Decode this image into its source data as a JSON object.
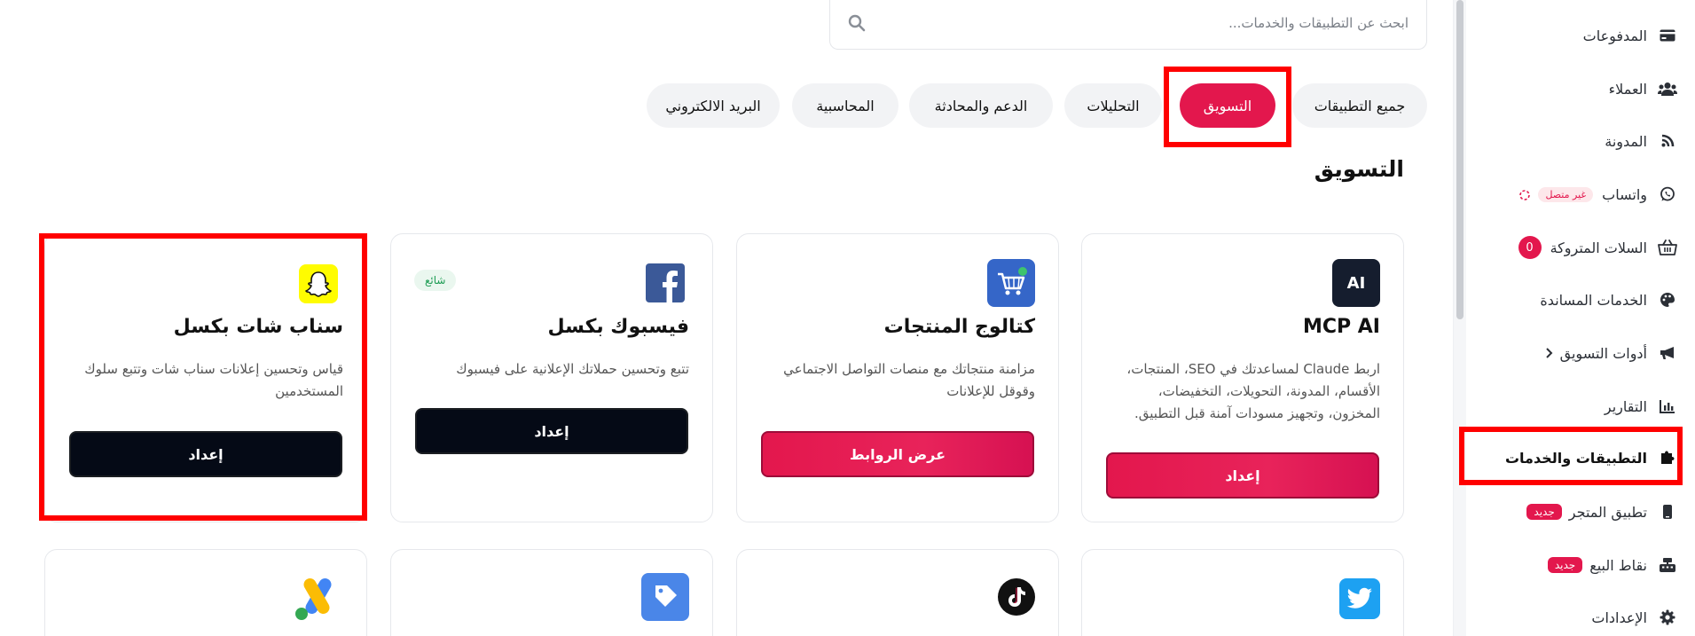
{
  "search": {
    "placeholder": "ابحث عن التطبيقات والخدمات..."
  },
  "tabs": [
    {
      "label": "جميع التطبيقات"
    },
    {
      "label": "التسويق",
      "active": true
    },
    {
      "label": "التحليلات"
    },
    {
      "label": "الدعم والمحادثة"
    },
    {
      "label": "المحاسبية"
    },
    {
      "label": "البريد الالكتروني"
    }
  ],
  "section_title": "التسويق",
  "cards": [
    {
      "name": "MCP AI",
      "logo_text": "AI",
      "icon": "ai-logo-icon",
      "desc": "اربط Claude لمساعدتك في SEO، المنتجات، الأقسام، المدونة، التحويلات، التخفيضات، المخزون، وتجهيز مسودات آمنة قبل التطبيق.",
      "button": "إعداد"
    },
    {
      "name": "كتالوج المنتجات",
      "icon": "cart-icon",
      "desc": "مزامنة منتجاتك مع منصات التواصل الاجتماعي وقوقل للإعلانات",
      "button": "عرض الروابط"
    },
    {
      "name": "فيسبوك بكسل",
      "icon": "facebook-icon",
      "desc": "تتبع وتحسين حملاتك الإعلانية على فيسبوك",
      "button": "إعداد",
      "badge": "شائع"
    },
    {
      "name": "سناب شات بكسل",
      "icon": "snapchat-icon",
      "desc": "قياس وتحسين إعلانات سناب شات وتتبع سلوك المستخدمين",
      "button": "إعداد"
    }
  ],
  "cards_row2": [
    {
      "icon": "twitter-icon"
    },
    {
      "icon": "tiktok-icon"
    },
    {
      "icon": "price-tag-icon"
    },
    {
      "icon": "google-ads-icon"
    }
  ],
  "sidebar": {
    "items": [
      {
        "label": "المدفوعات",
        "icon": "credit-card-icon"
      },
      {
        "label": "العملاء",
        "icon": "users-icon"
      },
      {
        "label": "المدونة",
        "icon": "blog-icon"
      },
      {
        "label": "واتساب",
        "icon": "whatsapp-icon",
        "status": "غير متصل"
      },
      {
        "label": "السلات المتروكة",
        "icon": "basket-icon",
        "count": "0"
      },
      {
        "label": "الخدمات المساندة",
        "icon": "palette-icon"
      },
      {
        "label": "أدوات التسويق",
        "icon": "megaphone-icon"
      },
      {
        "label": "التقارير",
        "icon": "chart-icon"
      },
      {
        "label": "التطبيقات والخدمات",
        "icon": "puzzle-icon",
        "active": true
      },
      {
        "label": "تطبيق المتجر",
        "icon": "mobile-icon",
        "badge": "جديد"
      },
      {
        "label": "نقاط البيع",
        "icon": "cash-register-icon",
        "badge": "جديد"
      },
      {
        "label": "الإعدادات",
        "icon": "gear-icon"
      }
    ]
  },
  "colors": {
    "accent": "#e3174d",
    "dark_button": "#050a16",
    "highlight_frame": "#ff0000"
  }
}
